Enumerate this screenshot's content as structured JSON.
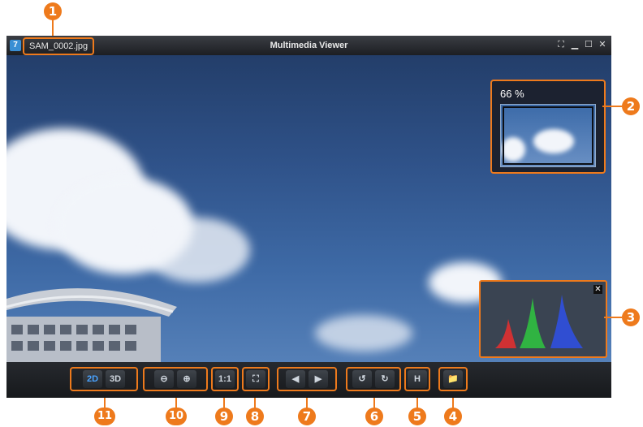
{
  "window": {
    "title": "Multimedia Viewer",
    "filename": "SAM_0002.jpg",
    "app_icon": "7",
    "controls": [
      "⛶",
      "▁",
      "☐",
      "✕"
    ]
  },
  "navigator": {
    "zoom": "66 %"
  },
  "histogram": {
    "close": "✕"
  },
  "toolbar": {
    "view_2d": "2D",
    "view_3d": "3D",
    "zoom_out": "⊖",
    "zoom_in": "⊕",
    "actual_size": "1:1",
    "fit_screen": "⛶",
    "prev": "◀",
    "next": "▶",
    "rotate_left": "↺",
    "rotate_right": "↻",
    "histogram": "H",
    "open_folder": "📁"
  },
  "callouts": {
    "c1": "1",
    "c2": "2",
    "c3": "3",
    "c4": "4",
    "c5": "5",
    "c6": "6",
    "c7": "7",
    "c8": "8",
    "c9": "9",
    "c10": "10",
    "c11": "11"
  },
  "colors": {
    "accent": "#ee7a1c",
    "active": "#4aa3ff"
  }
}
